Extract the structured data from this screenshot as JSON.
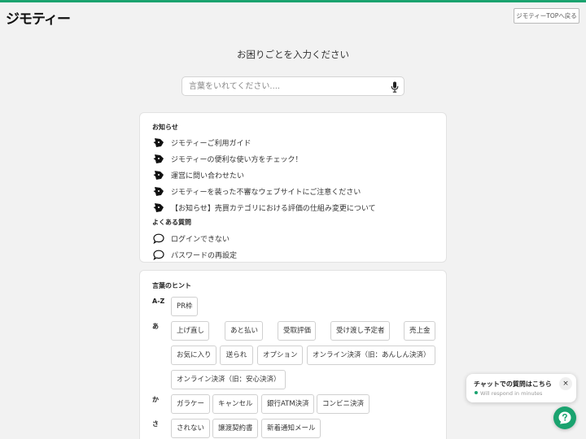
{
  "header": {
    "logo": "ジモティー",
    "top_link": "ジモティーTOPへ戻る",
    "accent": "#1aa36f"
  },
  "heading": "お困りごとを入力ください",
  "search": {
    "placeholder": "言葉をいれてください....",
    "value": "",
    "icon": "microphone-icon"
  },
  "notices": {
    "title": "お知らせ",
    "icon": "pen-nib-icon",
    "items": [
      "ジモティーご利用ガイド",
      "ジモティーの便利な使い方をチェック！",
      "運営に問い合わせたい",
      "ジモティーを装った不審なウェブサイトにご注意ください",
      "【お知らせ】売買カテゴリにおける評価の仕組み変更について"
    ]
  },
  "faq": {
    "title": "よくある質問",
    "icon": "speech-bubble-icon",
    "items": [
      "ログインできない",
      "パスワードの再設定"
    ]
  },
  "hints": {
    "title": "言葉のヒント",
    "groups": [
      {
        "letter": "A-Z",
        "chips": [
          "PR枠"
        ]
      },
      {
        "letter": "あ",
        "chips": [
          "上げ直し",
          "あと払い",
          "受取評価",
          "受け渡し予定者",
          "売上金",
          "お気に入り",
          "送られ",
          "オプション",
          "オンライン決済（旧：あんしん決済）",
          "オンライン決済（旧：安心決済）"
        ]
      },
      {
        "letter": "か",
        "chips": [
          "ガラケー",
          "キャンセル",
          "銀行ATM決済",
          "コンビニ決済"
        ]
      },
      {
        "letter": "さ",
        "chips": [
          "されない",
          "譲渡契約書",
          "新着通知メール"
        ]
      }
    ]
  },
  "chat_widget": {
    "title": "チャットでの質問はこちら",
    "status": "Will respond in minutes",
    "close": "×"
  }
}
